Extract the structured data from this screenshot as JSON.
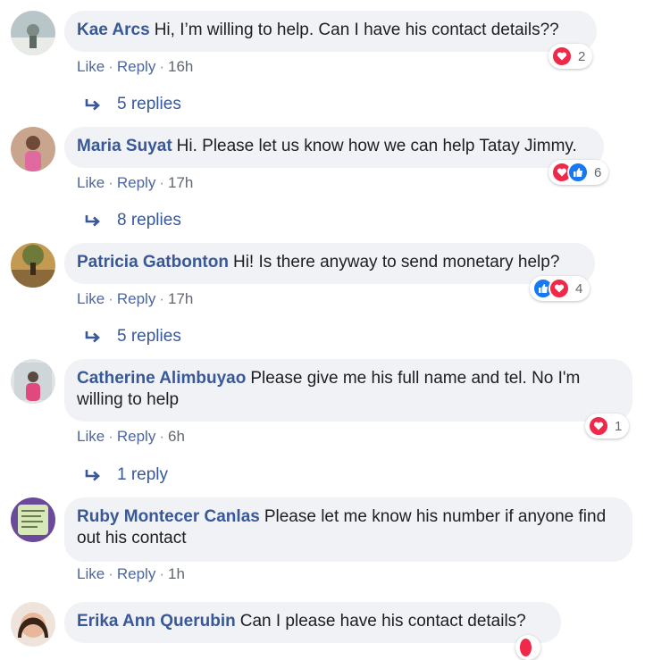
{
  "colors": {
    "link": "#385898",
    "love": "#f0284a",
    "like": "#1877f2",
    "bubble": "#f0f2f5"
  },
  "actions": {
    "like": "Like",
    "reply": "Reply",
    "separator": "·"
  },
  "comments": [
    {
      "author": "Kae Arcs",
      "text": "Hi, I’m willing to help. Can I have his contact details??",
      "time": "16h",
      "reactions": [
        "love"
      ],
      "reaction_count": "2",
      "replies": "5 replies"
    },
    {
      "author": "Maria Suyat",
      "text": "Hi. Please let us know how we can help Tatay Jimmy.",
      "time": "17h",
      "reactions": [
        "love",
        "like"
      ],
      "reaction_count": "6",
      "replies": "8 replies"
    },
    {
      "author": "Patricia Gatbonton",
      "text": "Hi! Is there anyway to send monetary help?",
      "time": "17h",
      "reactions": [
        "like",
        "love"
      ],
      "reaction_count": "4",
      "replies": "5 replies"
    },
    {
      "author": "Catherine Alimbuyao",
      "text": "Please give me his full name and tel. No I'm willing to help",
      "time": "6h",
      "reactions": [
        "love"
      ],
      "reaction_count": "1",
      "replies": "1 reply"
    },
    {
      "author": "Ruby Montecer Canlas",
      "text": "Please let me know his number if anyone find out his contact",
      "time": "1h"
    },
    {
      "author": "Erika Ann Querubin",
      "text": "Can I please have his contact details?"
    }
  ]
}
